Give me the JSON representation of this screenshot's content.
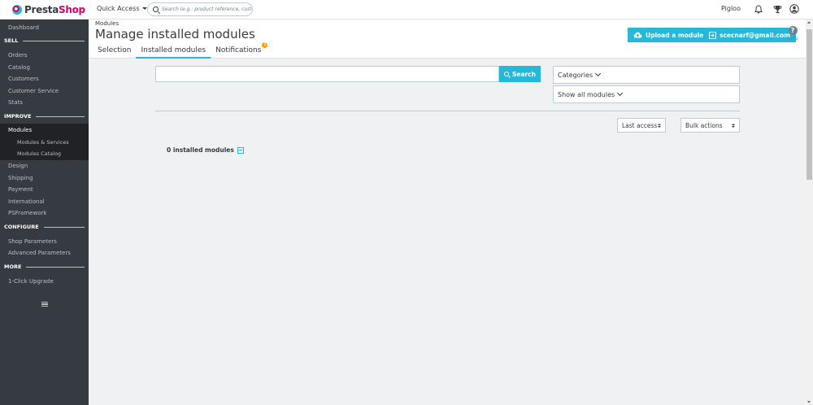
{
  "topbar": {
    "logo": {
      "prefix": "Presta",
      "suffix": "Shop"
    },
    "quick_access": "Quick Access",
    "search_placeholder": "Search (e.g.: product reference, custome",
    "shop_name": "Pigloo",
    "icons": [
      "bell-icon",
      "trophy-icon",
      "user-icon"
    ]
  },
  "sidebar": {
    "dashboard": "Dashboard",
    "sections": {
      "sell": "SELL",
      "improve": "IMPROVE",
      "configure": "CONFIGURE",
      "more": "MORE"
    },
    "items": {
      "orders": "Orders",
      "catalog": "Catalog",
      "customers": "Customers",
      "customer_service": "Customer Service",
      "stats": "Stats",
      "modules": "Modules",
      "modules_services": "Modules & Services",
      "modules_catalog": "Modules Catalog",
      "design": "Design",
      "shipping": "Shipping",
      "payment": "Payment",
      "international": "International",
      "psframework": "PSFramework",
      "shop_parameters": "Shop Parameters",
      "advanced_parameters": "Advanced Parameters",
      "one_click_upgrade": "1-Click Upgrade"
    }
  },
  "header": {
    "breadcrumb": "Modules",
    "title": "Manage installed modules",
    "tabs": [
      {
        "label": "Selection",
        "active": false
      },
      {
        "label": "Installed modules",
        "active": true
      },
      {
        "label": "Notifications",
        "active": false,
        "badge": "1"
      }
    ],
    "upload_button": "Upload a module",
    "account_button": "scecnarf@gmail.com",
    "help": {
      "glyph": "?",
      "label": "Help"
    }
  },
  "main": {
    "search_value": "",
    "search_button": "Search",
    "categories_label": "Categories",
    "show_all_label": "Show all modules",
    "sort_label": "Last access",
    "bulk_label": "Bulk actions",
    "installed_count_text": "0 installed modules"
  },
  "colors": {
    "accent": "#25b9d7",
    "sidebar_bg": "#363a41",
    "sidebar_active": "#202226",
    "page_bg": "#eff1f2",
    "badge": "#ff9a00",
    "brand_pink": "#df0067"
  }
}
